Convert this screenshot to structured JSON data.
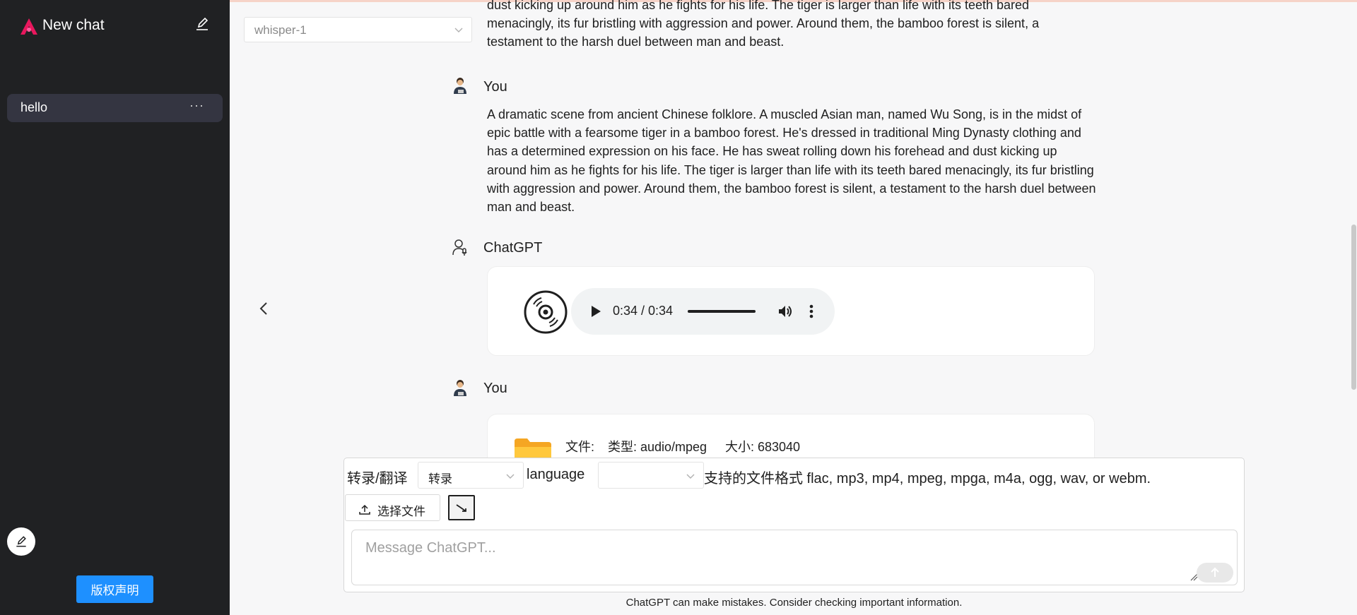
{
  "sidebar": {
    "title": "New chat",
    "chat_items": [
      {
        "title": "hello",
        "more": "···"
      }
    ],
    "copyright_button": "版权声明"
  },
  "model_select": {
    "value": "whisper-1"
  },
  "messages": {
    "assistant_text_1": "dust kicking up around him as he fights for his life. The tiger is larger than life with its teeth bared menacingly, its fur bristling with aggression and power. Around them, the bamboo forest is silent, a testament to the harsh duel between man and beast.",
    "user_1": {
      "author": "You",
      "text": "A dramatic scene from ancient Chinese folklore. A muscled Asian man, named Wu Song, is in the midst of epic battle with a fearsome tiger in a bamboo forest. He's dressed in traditional Ming Dynasty clothing and has a determined expression on his face. He has sweat rolling down his forehead and dust kicking up around him as he fights for his life. The tiger is larger than life with its teeth bared menacingly, its fur bristling with aggression and power. Around them, the bamboo forest is silent, a testament to the harsh duel between man and beast."
    },
    "assistant_2": {
      "author": "ChatGPT",
      "audio_time": "0:34 / 0:34"
    },
    "user_2": {
      "author": "You",
      "file_label": "文件:",
      "file_type": "类型: audio/mpeg",
      "file_size": "大小: 683040"
    }
  },
  "composer": {
    "mode_label": "转录/翻译",
    "mode_value": "转录",
    "language_label": "language",
    "language_value": "",
    "formats_text": "支持的文件格式 flac, mp3, mp4, mpeg, mpga, m4a, ogg, wav, or webm.",
    "upload_label": "选择文件",
    "placeholder": "Message ChatGPT..."
  },
  "disclaimer": "ChatGPT can make mistakes. Consider checking important information.",
  "colors": {
    "sidebar_bg": "#202123",
    "accent": "#1e90ff",
    "logo": "#e8175d"
  }
}
